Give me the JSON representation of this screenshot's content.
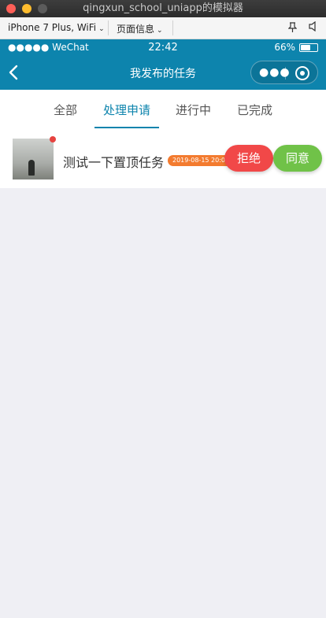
{
  "window": {
    "title": "qingxun_school_uniapp的模拟器"
  },
  "devtools": {
    "device": "iPhone 7 Plus, WiFi",
    "page_info": "页面信息"
  },
  "statusbar": {
    "signal": "●●●●● WeChat",
    "time": "22:42",
    "battery": "66%",
    "battery_level": 0.66
  },
  "navbar": {
    "title": "我发布的任务"
  },
  "tabs": [
    {
      "label": "全部"
    },
    {
      "label": "处理申请"
    },
    {
      "label": "进行中"
    },
    {
      "label": "已完成"
    }
  ],
  "active_tab": 1,
  "tasks": [
    {
      "title": "测试一下置顶任务",
      "time": "2019-08-15 20:05:",
      "reject_label": "拒绝",
      "agree_label": "同意",
      "unread": true
    }
  ],
  "colors": {
    "accent": "#0d84ad",
    "reject": "#f14848",
    "agree": "#70c248",
    "badge": "#f37b2f",
    "unread_dot": "#e64340"
  }
}
